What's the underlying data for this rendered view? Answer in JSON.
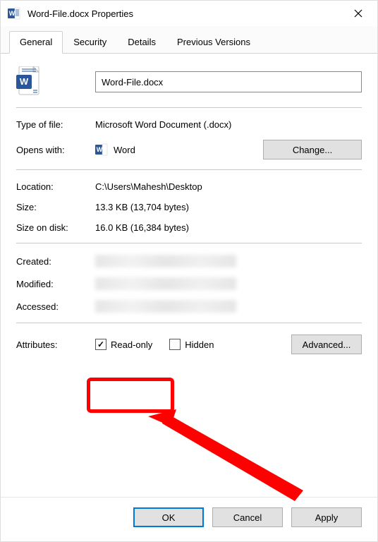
{
  "window": {
    "title": "Word-File.docx Properties"
  },
  "tabs": {
    "items": [
      "General",
      "Security",
      "Details",
      "Previous Versions"
    ],
    "active_index": 0
  },
  "general": {
    "filename": "Word-File.docx",
    "type_label": "Type of file:",
    "type_value": "Microsoft Word Document (.docx)",
    "opens_label": "Opens with:",
    "opens_app": "Word",
    "change_button": "Change...",
    "location_label": "Location:",
    "location_value": "C:\\Users\\Mahesh\\Desktop",
    "size_label": "Size:",
    "size_value": "13.3 KB (13,704 bytes)",
    "size_on_disk_label": "Size on disk:",
    "size_on_disk_value": "16.0 KB (16,384 bytes)",
    "created_label": "Created:",
    "modified_label": "Modified:",
    "accessed_label": "Accessed:",
    "attributes_label": "Attributes:",
    "readonly_label": "Read-only",
    "readonly_checked": true,
    "hidden_label": "Hidden",
    "hidden_checked": false,
    "advanced_button": "Advanced..."
  },
  "buttons": {
    "ok": "OK",
    "cancel": "Cancel",
    "apply": "Apply"
  },
  "annotation": {
    "highlight_target": "readonly-checkbox"
  }
}
